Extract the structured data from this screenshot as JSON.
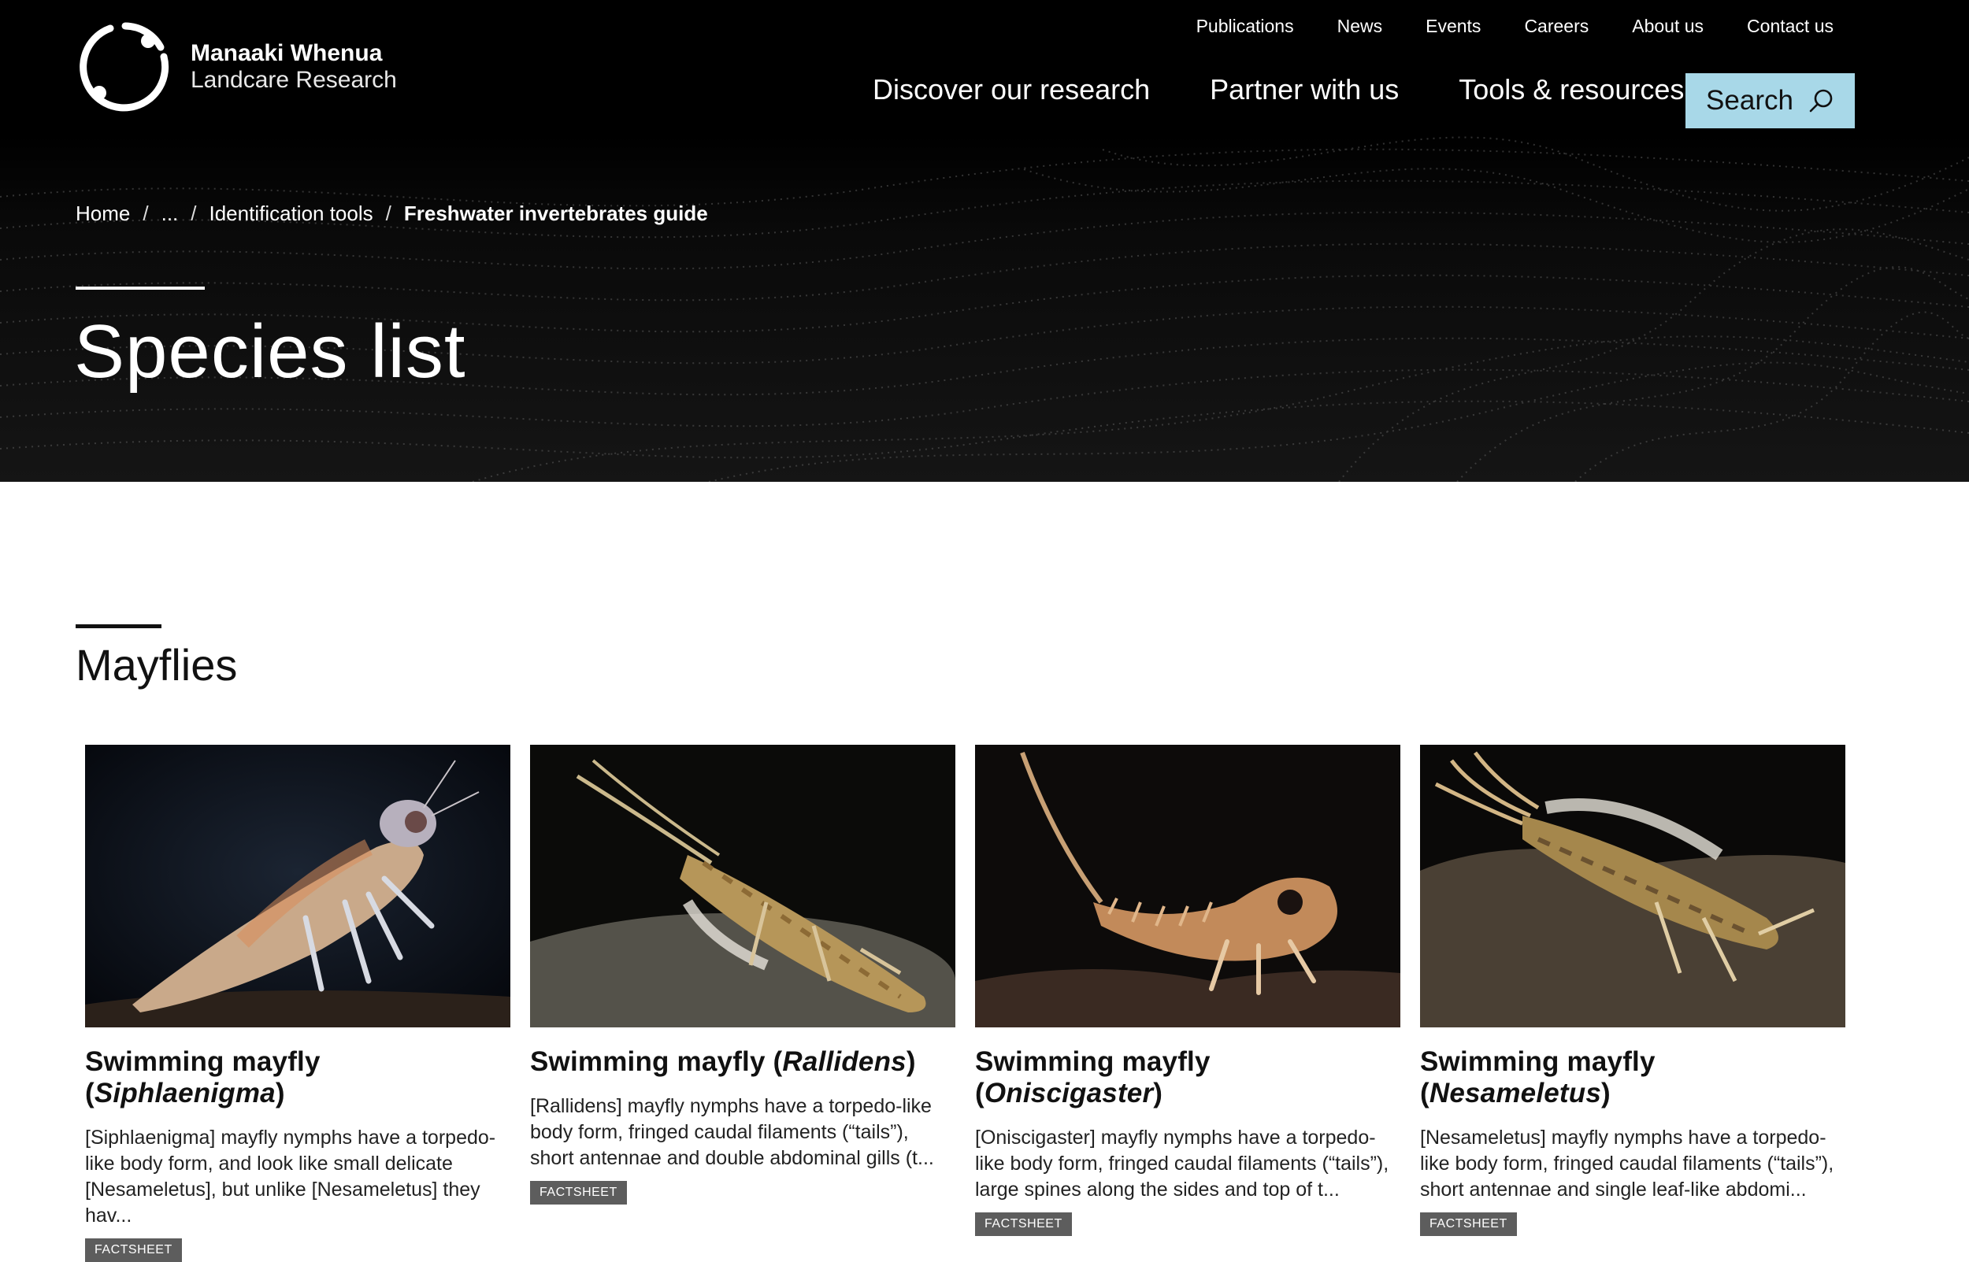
{
  "brand": {
    "line1": "Manaaki Whenua",
    "line2": "Landcare Research"
  },
  "utility_nav": [
    "Publications",
    "News",
    "Events",
    "Careers",
    "About us",
    "Contact us"
  ],
  "main_nav": [
    "Discover our research",
    "Partner with us",
    "Tools & resources"
  ],
  "search": {
    "label": "Search"
  },
  "breadcrumb": {
    "home": "Home",
    "ellipsis": "...",
    "parent": "Identification tools",
    "current": "Freshwater invertebrates guide",
    "separator": "/"
  },
  "page": {
    "title": "Species list"
  },
  "section": {
    "title": "Mayflies"
  },
  "cards": [
    {
      "title_prefix": "Swimming mayfly (",
      "genus": "Siphlaenigma",
      "title_suffix": ")",
      "description": "[Siphlaenigma] mayfly nymphs have a torpedo-like body form, and look like small delicate [Nesameletus], but unlike [Nesameletus] they hav...",
      "badge": "FACTSHEET"
    },
    {
      "title_prefix": "Swimming mayfly (",
      "genus": "Rallidens",
      "title_suffix": ")",
      "description": "[Rallidens] mayfly nymphs have a torpedo-like body form, fringed caudal filaments (“tails”), short antennae and double abdominal gills (t...",
      "badge": "FACTSHEET"
    },
    {
      "title_prefix": "Swimming mayfly (",
      "genus": "Oniscigaster",
      "title_suffix": ")",
      "description": "[Oniscigaster] mayfly nymphs have a torpedo-like body form, fringed caudal filaments (“tails”), large spines along the sides and top of t...",
      "badge": "FACTSHEET"
    },
    {
      "title_prefix": "Swimming mayfly (",
      "genus": "Nesameletus",
      "title_suffix": ")",
      "description": "[Nesameletus] mayfly nymphs have a torpedo-like body form, fringed caudal filaments (“tails”), short antennae and single leaf-like abdomi...",
      "badge": "FACTSHEET"
    }
  ],
  "colors": {
    "header_bg": "#000000",
    "search_bg": "#a8d8e8",
    "badge_bg": "#5d5d5d"
  }
}
